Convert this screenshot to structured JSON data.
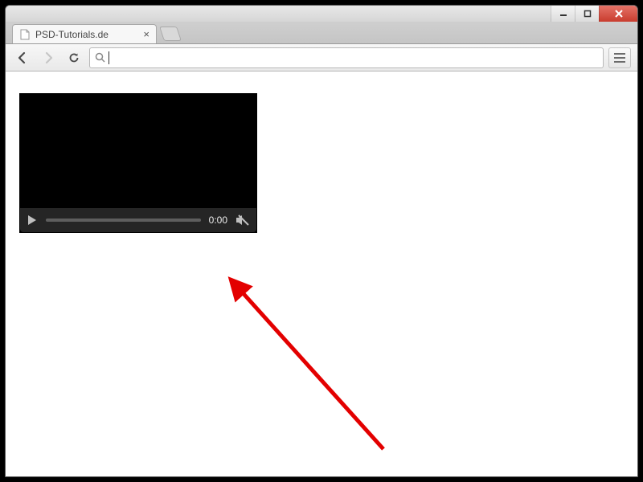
{
  "window": {
    "tab_title": "PSD-Tutorials.de"
  },
  "toolbar": {
    "omnibox_value": ""
  },
  "video": {
    "time_label": "0:00"
  }
}
